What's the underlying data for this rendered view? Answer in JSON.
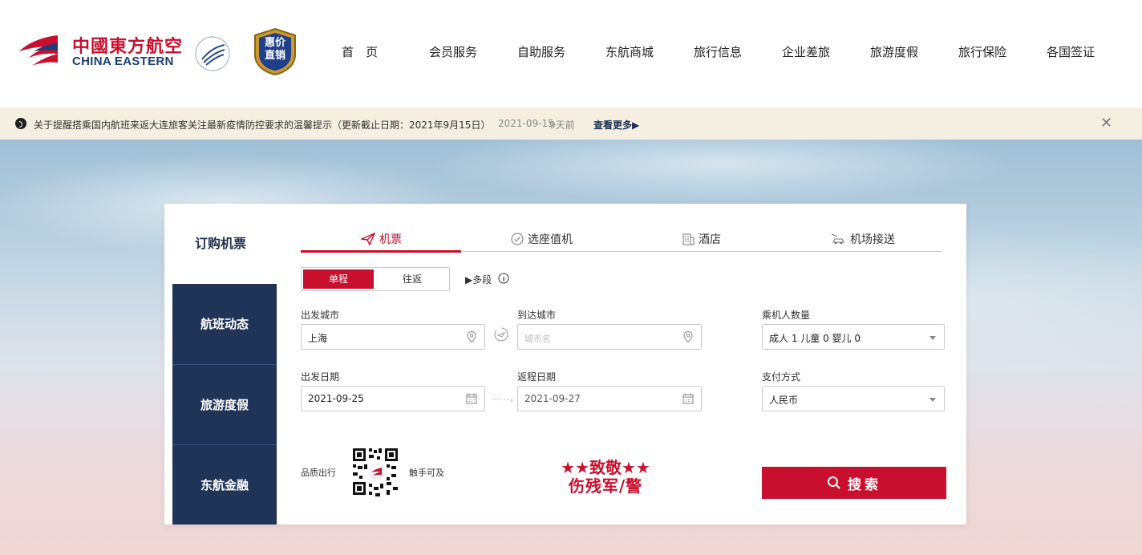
{
  "brand": {
    "cn": "中國東方航空",
    "en": "CHINA EASTERN",
    "badge_top": "惠价",
    "badge_bottom": "直销"
  },
  "nav": [
    "首　页",
    "会员服务",
    "自助服务",
    "东航商城",
    "旅行信息",
    "企业差旅",
    "旅游度假",
    "旅行保险",
    "各国签证"
  ],
  "notice": {
    "text": "关于提醒搭乘国内航班来返大连旅客关注最新疫情防控要求的温馨提示（更新截止日期：2021年9月15日）",
    "date": "2021-09-15",
    "ago": "9天前",
    "more": "查看更多▶"
  },
  "side_menu": [
    "订购机票",
    "航班动态",
    "旅游度假",
    "东航金融"
  ],
  "tabs": [
    "机票",
    "选座值机",
    "酒店",
    "机场接送"
  ],
  "trip_type": {
    "one_way": "单程",
    "round_trip": "往返",
    "multi": "▶多段"
  },
  "form": {
    "departure_label": "出发城市",
    "departure_value": "上海",
    "arrival_label": "到达城市",
    "arrival_placeholder": "城市名",
    "passengers_label": "乘机人数量",
    "passengers_value": "成人 1  儿童 0  婴儿 0",
    "depart_date_label": "出发日期",
    "depart_date_value": "2021-09-25",
    "return_date_label": "返程日期",
    "return_date_value": "2021-09-27",
    "payment_label": "支付方式",
    "payment_value": "人民币"
  },
  "promo": {
    "quality": "品质出行",
    "reach": "触手可及",
    "tribute_top": "★★致敬★★",
    "tribute_bottom": "伤残军/警"
  },
  "search_label": "搜索",
  "colors": {
    "brand_red": "#c8102e",
    "navy": "#1f3457"
  }
}
